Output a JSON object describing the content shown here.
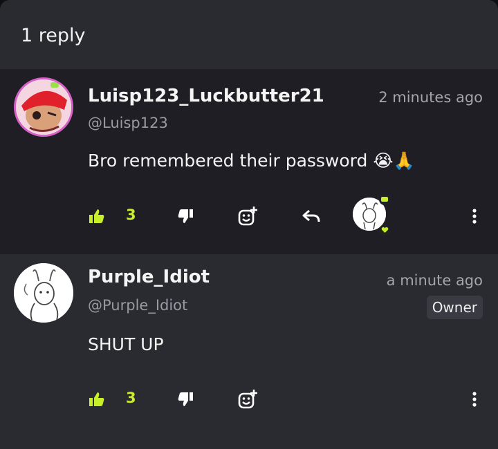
{
  "header": {
    "title": "1 reply"
  },
  "comments": [
    {
      "username": "Luisp123_Luckbutter21",
      "handle": "@Luisp123",
      "timestamp": "2 minutes ago",
      "text": "Bro remembered their password 😭🙏",
      "likes": "3"
    },
    {
      "username": "Purple_Idiot",
      "handle": "@Purple_Idiot",
      "timestamp": "a minute ago",
      "badge": "Owner",
      "text": "SHUT UP",
      "likes": "3"
    }
  ],
  "colors": {
    "accent": "#c7ef2a",
    "avatar_ring": "#d760c6",
    "background": "#23232a"
  },
  "icons": [
    "like-icon",
    "dislike-icon",
    "react-icon",
    "reply-icon",
    "more-icon"
  ]
}
